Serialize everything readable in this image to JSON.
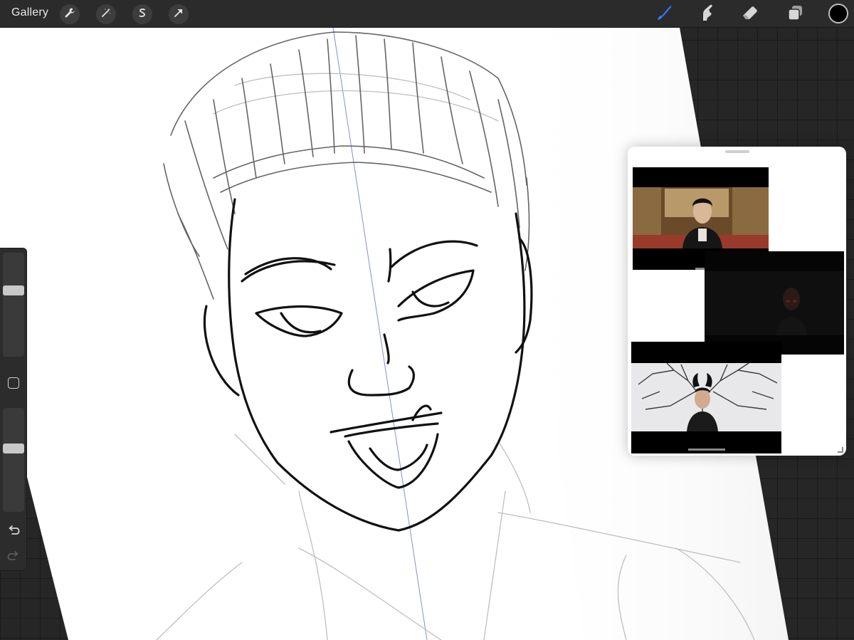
{
  "topbar": {
    "gallery_label": "Gallery",
    "left_tools": [
      {
        "name": "actions",
        "icon": "wrench-icon"
      },
      {
        "name": "adjustments",
        "icon": "magic-wand-icon"
      },
      {
        "name": "selection",
        "icon": "selection-s-icon"
      },
      {
        "name": "transform",
        "icon": "arrow-cursor-icon"
      }
    ],
    "right_tools": [
      {
        "name": "brush",
        "icon": "brush-icon",
        "active": true
      },
      {
        "name": "smudge",
        "icon": "smudge-finger-icon"
      },
      {
        "name": "eraser",
        "icon": "eraser-icon"
      },
      {
        "name": "layers",
        "icon": "layers-icon"
      }
    ],
    "active_color": "#000000",
    "active_tool_color": "#2f7df6"
  },
  "sidebar": {
    "brush_size_level": 0.65,
    "opacity_level": 0.62,
    "modify_icon": "square-modify-icon",
    "undo_icon": "undo-icon",
    "redo_icon": "redo-icon"
  },
  "reference_panel": {
    "images": [
      {
        "name": "reference-image-1",
        "description_icon": "video-still"
      },
      {
        "name": "reference-image-2",
        "description_icon": "video-still"
      },
      {
        "name": "reference-image-3",
        "description_icon": "video-still"
      }
    ]
  },
  "colors": {
    "canvas_bg": "#ffffff",
    "toolbar_bg": "#2b2b2b",
    "workspace_bg": "#262626",
    "guide_line": "#6a7de8"
  }
}
